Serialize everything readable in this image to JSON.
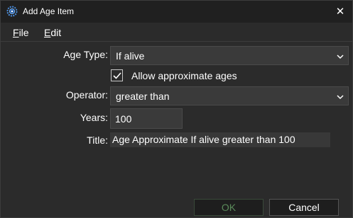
{
  "window": {
    "title": "Add Age Item",
    "close_glyph": "✕"
  },
  "menu": {
    "file_accel": "F",
    "file_rest": "ile",
    "edit_accel": "E",
    "edit_rest": "dit"
  },
  "form": {
    "age_type_label": "Age Type:",
    "age_type_value": "If alive",
    "allow_approx_label": "Allow approximate ages",
    "allow_approx_checked": true,
    "operator_label": "Operator:",
    "operator_value": "greater than",
    "years_label": "Years:",
    "years_value": "100",
    "title_label": "Title:",
    "title_value": "Age Approximate If alive greater than 100"
  },
  "buttons": {
    "ok_label": "OK",
    "cancel_label": "Cancel"
  },
  "colors": {
    "background": "#2b2b2b",
    "titlebar": "#202020",
    "field": "#3a3a3a",
    "ok_text_disabled": "#5a8a5a"
  },
  "icons": {
    "app": "gear-app-icon",
    "close": "close-icon",
    "dropdown": "chevron-down-icon",
    "check": "checkmark-icon"
  }
}
